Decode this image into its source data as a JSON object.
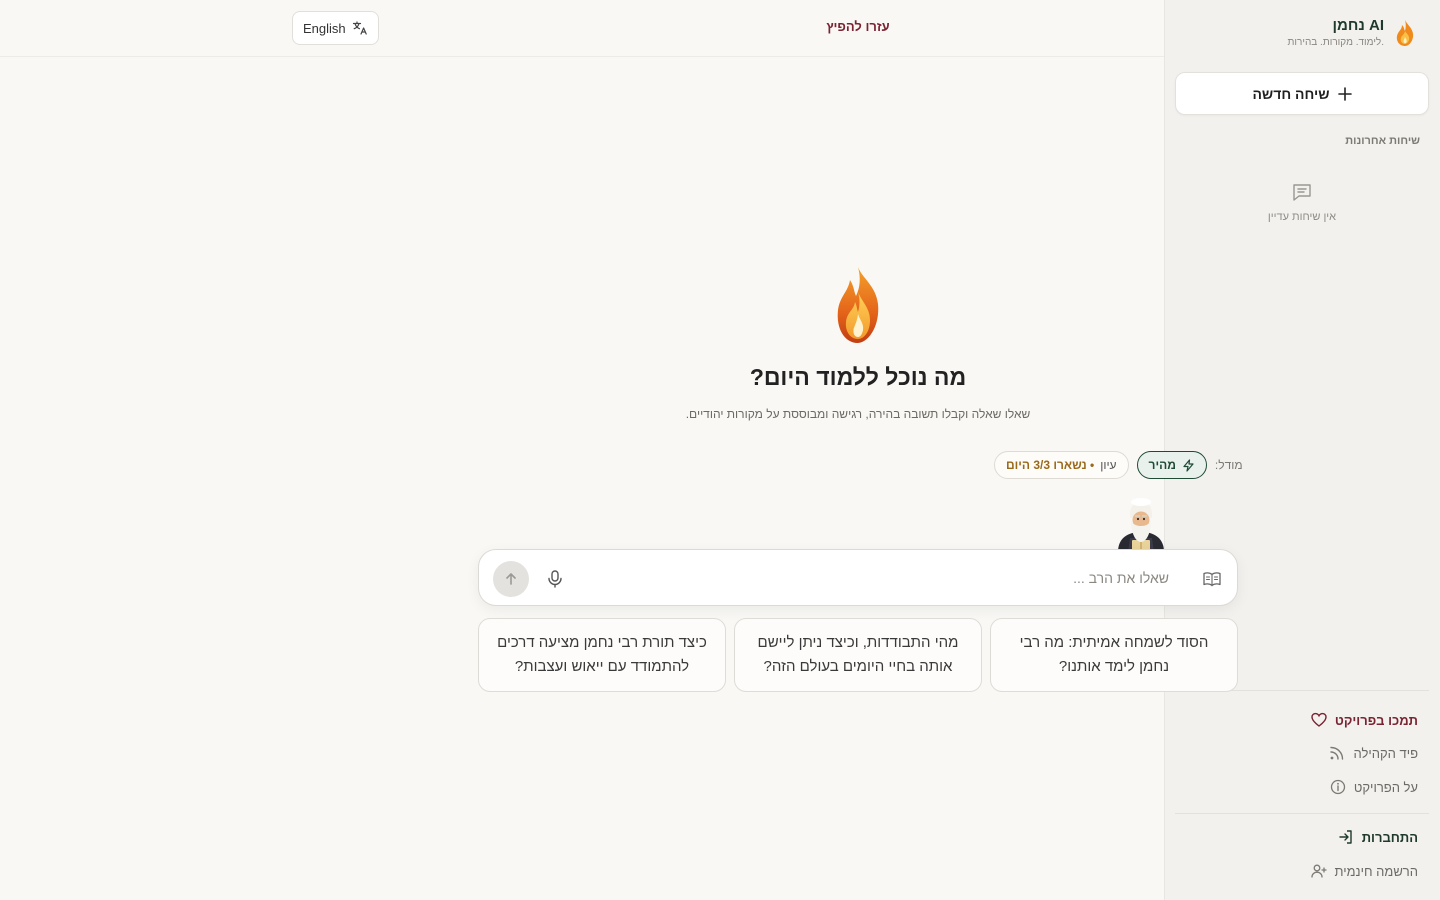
{
  "app": {
    "name": "נחמן AI",
    "tagline": "לימוד. מקורות. בהירות."
  },
  "header": {
    "language_button": "English",
    "title": "עזרו להפיץ"
  },
  "sidebar": {
    "new_chat_label": "שיחה חדשה",
    "recent_title": "שיחות אחרונות",
    "empty_recent": "אין שיחות עדיין",
    "links": {
      "donate": "תמכו בפרויקט",
      "community_feed": "פיד הקהילה",
      "about": "על הפרויקט",
      "login": "התחברות",
      "register": "הרשמה חינמית"
    }
  },
  "main": {
    "title": "מה נוכל ללמוד היום?",
    "subtitle": "שאלו שאלה וקבלו תשובה בהירה, רגישה ומבוססת על מקורות יהודיים.",
    "model_label": "מודל:",
    "model_fast": "מהיר",
    "model_deep": "עיון",
    "model_deep_quota": "• נשארו 3/3 היום",
    "input_placeholder": "שאלו את הרב ...",
    "suggestions": [
      "הסוד לשמחה אמיתית: מה רבי נחמן לימד אותנו?",
      "מהי התבודדות, וכיצד ניתן ליישם אותה בחיי היומים בעולם הזה?",
      "כיצד תורת רבי נחמן מציעה דרכים להתמודד עם ייאוש ועצבות?"
    ]
  },
  "colors": {
    "accent_green": "#1f4a36",
    "accent_burgundy": "#7a2432",
    "flame_orange": "#f08a1c"
  }
}
